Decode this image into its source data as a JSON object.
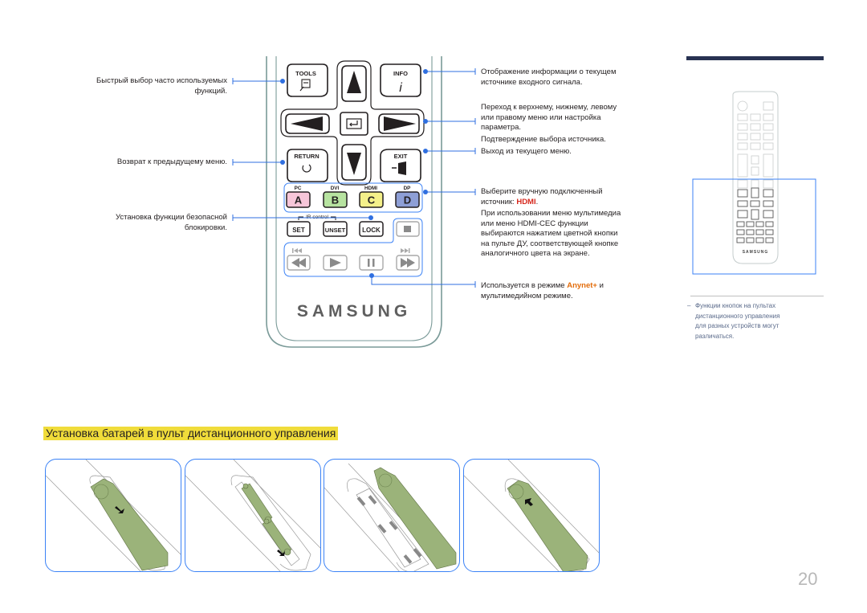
{
  "remote": {
    "buttons": {
      "tools": "TOOLS",
      "info": "INFO",
      "info_glyph": "i",
      "return": "RETURN",
      "exit": "EXIT",
      "color_labels": [
        "PC",
        "DVI",
        "HDMI",
        "DP"
      ],
      "color_keys": [
        {
          "key": "A",
          "color": "#f7c6d9"
        },
        {
          "key": "B",
          "color": "#b7e3a0"
        },
        {
          "key": "C",
          "color": "#f4f08a"
        },
        {
          "key": "D",
          "color": "#8e9fd6"
        }
      ],
      "ir_control": "IR control",
      "set": "SET",
      "unset": "UNSET",
      "lock": "LOCK"
    },
    "brand": "SAMSUNG"
  },
  "callouts_left": {
    "tools": [
      "Быстрый выбор часто используемых",
      "функций."
    ],
    "return": [
      "Возврат к предыдущему меню."
    ],
    "lock": [
      "Установка функции безопасной",
      "блокировки."
    ]
  },
  "callouts_right": {
    "info": [
      "Отображение информации о текущем",
      "источнике входного сигнала."
    ],
    "arrows": [
      "Переход к верхнему, нижнему, левому",
      "или правому меню или настройка",
      "параметра."
    ],
    "enter": "Подтверждение выбора источника.",
    "exit": "Выход из текущего меню.",
    "color_line1": "Выберите вручную подключенный",
    "color_line2_prefix": "источник: ",
    "color_line2_highlight": "HDMI",
    "color_line2_suffix": ".",
    "color_extra": [
      "При использовании меню мультимедиа",
      "или меню HDMI-CEC функции",
      "выбираются нажатием цветной кнопки",
      "на пульте ДУ, соответствующей кнопке",
      "аналогичного цвета на экране."
    ],
    "media_prefix": "Используется в режиме ",
    "media_highlight": "Anynet+",
    "media_suffix": " и",
    "media_line2": "мультимедийном режиме."
  },
  "sidebar": {
    "thumb_brand": "SAMSUNG",
    "note_dash": "–",
    "note": [
      "Функции кнопок на пультах",
      "дистанционного управления",
      "для разных устройств могут",
      "различаться."
    ]
  },
  "battery_section": {
    "title": "Установка батарей в пульт дистанционного управления",
    "steps": [
      "step-1",
      "step-2",
      "step-3",
      "step-4"
    ]
  },
  "page_number": "20",
  "colors": {
    "accent_blue": "#2f6fe0",
    "highlight_yellow": "#f0dc3a",
    "cover_green": "#9bb37a",
    "header_bar": "#283252"
  }
}
